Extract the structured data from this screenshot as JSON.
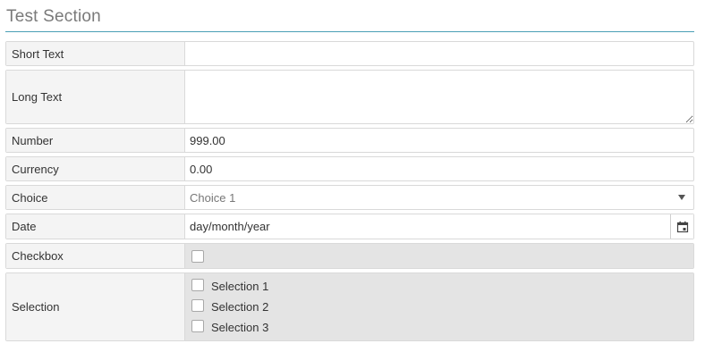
{
  "section": {
    "title": "Test Section"
  },
  "fields": {
    "short_text": {
      "label": "Short Text",
      "value": ""
    },
    "long_text": {
      "label": "Long Text",
      "value": ""
    },
    "number": {
      "label": "Number",
      "value": "999.00"
    },
    "currency": {
      "label": "Currency",
      "value": "0.00"
    },
    "choice": {
      "label": "Choice",
      "value": "Choice 1"
    },
    "date": {
      "label": "Date",
      "value": "day/month/year"
    },
    "checkbox": {
      "label": "Checkbox",
      "checked": false
    },
    "selection": {
      "label": "Selection",
      "options": [
        {
          "label": "Selection 1",
          "checked": false
        },
        {
          "label": "Selection 2",
          "checked": false
        },
        {
          "label": "Selection 3",
          "checked": false
        }
      ]
    }
  },
  "colors": {
    "accent_rule": "#4a9fb5",
    "label_bg": "#f4f4f4",
    "disabled_bg": "#e4e4e4"
  },
  "icons": {
    "date_picker": "calendar-icon",
    "choice_dropdown": "caret-down-icon"
  }
}
